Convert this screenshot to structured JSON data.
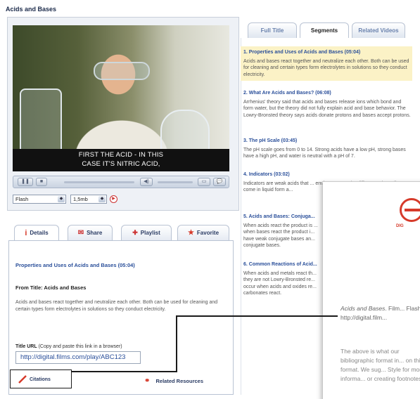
{
  "page": {
    "title": "Acids and Bases"
  },
  "video": {
    "caption_line1": "FIRST THE ACID - IN THIS",
    "caption_line2": "CASE IT'S NITRIC ACID,"
  },
  "player": {
    "format_select": "Flash",
    "size_select": "1,5mb"
  },
  "details_tabs": [
    {
      "label": "Details",
      "icon": "info-icon",
      "active": true
    },
    {
      "label": "Share",
      "icon": "mail-icon",
      "active": false
    },
    {
      "label": "Playlist",
      "icon": "playlist-icon",
      "active": false
    },
    {
      "label": "Favorite",
      "icon": "star-icon",
      "active": false
    }
  ],
  "details": {
    "segment_title": "Properties and Uses of Acids and Bases (05:04)",
    "from_title": "From Title: Acids and Bases",
    "description": "Acids and bases react together and neutralize each other. Both can be used for cleaning and certain types form electrolytes in solutions so they conduct electricity.",
    "url_label_bold": "Title URL",
    "url_label_rest": "(Copy and paste this link in a browser)",
    "url_value": "http://digital.films.com/play/ABC123",
    "citations_label": "Citations",
    "related_label": "Related Resources"
  },
  "right_tabs": [
    {
      "label": "Full Title",
      "active": false
    },
    {
      "label": "Segments",
      "active": true
    },
    {
      "label": "Related Videos",
      "active": false
    }
  ],
  "segments": [
    {
      "title": "1. Properties and Uses of Acids and Bases (05:04)",
      "text": "Acids and bases react together and neutralize each other. Both can be used for cleaning and certain types form electrolytes in solutions so they conduct electricity."
    },
    {
      "title": "2. What Are Acids and Bases? (06:08)",
      "text": "Arrhenius' theory said that acids and bases release ions which bond and form water, but the theory did not fully explain acid and base behavior. The Lowry-Bronsted theory says acids donate protons and bases accept protons."
    },
    {
      "title": "3. The pH Scale (03:45)",
      "text": "The pH scale goes from 0 to 14. Strong acids have a low pH, strong bases have a high pH, and water is neutral with a pH of 7."
    },
    {
      "title": "4. Indicators (03:02)",
      "text": "Indicators are weak acids that ... environment and a different col... Indicators come in liquid form a..."
    },
    {
      "title": "5. Acids and Bases: Conjuga...",
      "text": "When acids react the product is ... when bases react the product i... have weak conjugate bases an... conjugate bases."
    },
    {
      "title": "6. Common Reactions of Acid...",
      "text": "When acids and metals react th... they are not Lowry-Bronsted re... occur when acids and oxides re... carbonates react."
    }
  ],
  "popup": {
    "logo_text": "DIG",
    "cite_italic": "Acids and Bases",
    "cite_rest": ". Film... Flash. http://digital.film...",
    "note": "The above is what our bibliographic format in... on this format. We sug... Style for more informa... or creating footnotes."
  },
  "colors": {
    "accent": "#2a4f9a",
    "highlight": "#fbf2c6",
    "brand_red": "#d63a2a"
  }
}
